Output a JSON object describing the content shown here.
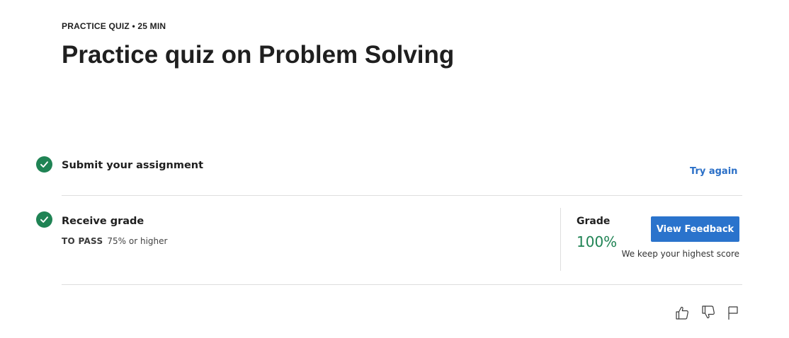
{
  "header": {
    "eyebrow": "PRACTICE QUIZ • 25 MIN",
    "title": "Practice quiz on Problem Solving"
  },
  "steps": [
    {
      "title": "Submit your assignment",
      "action_label": "Try again",
      "status_icon": "check-circle-icon"
    },
    {
      "title": "Receive grade",
      "pass_label": "TO PASS",
      "pass_value": "75% or higher",
      "status_icon": "check-circle-icon"
    }
  ],
  "grade": {
    "label": "Grade",
    "value": "100%",
    "button_label": "View Feedback",
    "note": "We keep your highest score"
  },
  "feedback_icons": [
    "thumbs-up-icon",
    "thumbs-down-icon",
    "flag-icon"
  ],
  "colors": {
    "success": "#1f8354",
    "primary": "#2a73cc",
    "link": "#2a6fc7"
  }
}
